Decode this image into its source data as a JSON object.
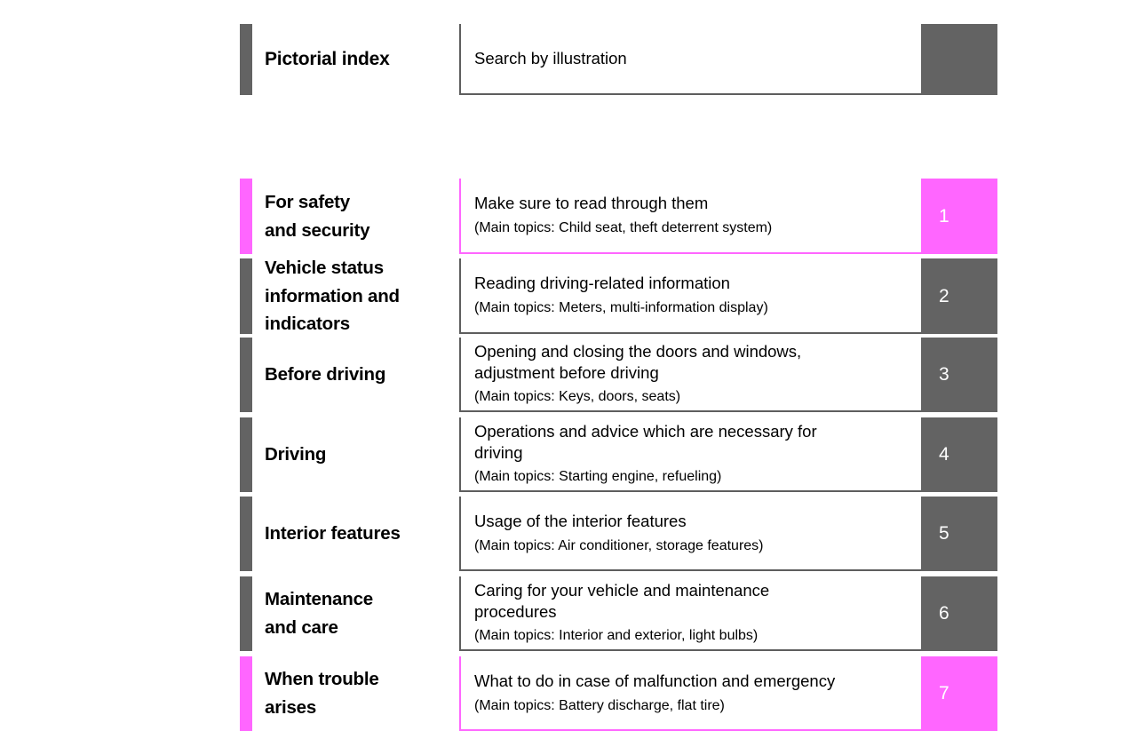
{
  "colors": {
    "gray": "#636363",
    "gray_border": "#5e5e5e",
    "magenta": "#ff66ff",
    "text": "#000000",
    "badge_text": "#ffffff",
    "page_background": "#ffffff"
  },
  "header": {
    "title": "Pictorial index",
    "description": "Search by illustration",
    "badge": "",
    "accent": "gray"
  },
  "chapters": [
    {
      "number": "1",
      "title": "For safety\nand security",
      "description": "Make sure to read through them",
      "topics": "(Main topics: Child seat, theft deterrent system)",
      "accent": "magenta"
    },
    {
      "number": "2",
      "title": "Vehicle status\ninformation and\nindicators",
      "description": "Reading driving-related information",
      "topics": "(Main topics: Meters, multi-information display)",
      "accent": "gray"
    },
    {
      "number": "3",
      "title": "Before driving",
      "description": "Opening and closing the doors and windows,\nadjustment before driving",
      "topics": "(Main topics: Keys, doors, seats)",
      "accent": "gray"
    },
    {
      "number": "4",
      "title": "Driving",
      "description": "Operations and advice which are necessary for\ndriving",
      "topics": "(Main topics: Starting engine, refueling)",
      "accent": "gray"
    },
    {
      "number": "5",
      "title": "Interior features",
      "description": "Usage of the interior features",
      "topics": "(Main topics: Air conditioner, storage features)",
      "accent": "gray"
    },
    {
      "number": "6",
      "title": "Maintenance\nand care",
      "description": "Caring for your vehicle and maintenance\nprocedures",
      "topics": "(Main topics: Interior and exterior, light bulbs)",
      "accent": "gray"
    },
    {
      "number": "7",
      "title": "When trouble\narises",
      "description": "What to do in case of malfunction and emergency",
      "topics": "(Main topics: Battery discharge, flat tire)",
      "accent": "magenta"
    }
  ]
}
